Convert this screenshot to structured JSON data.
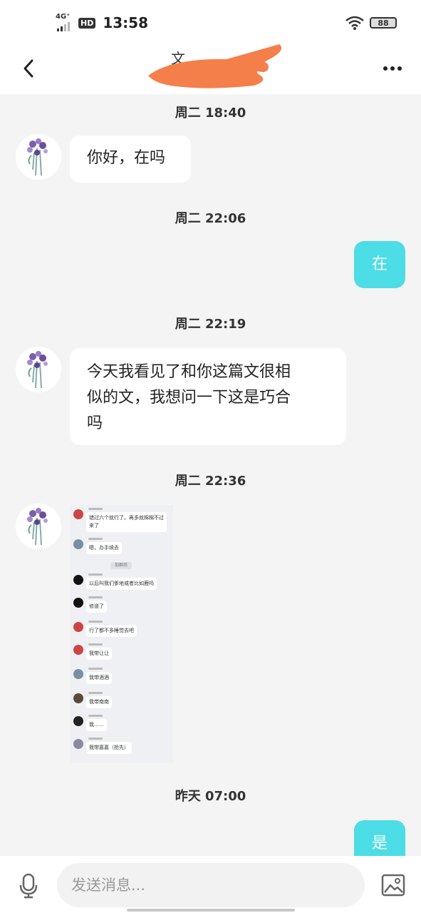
{
  "status_bar": {
    "network": "4G⁺",
    "hd": "HD",
    "time": "13:58",
    "battery": "88"
  },
  "header": {
    "title": "文"
  },
  "messages": [
    {
      "type": "timestamp",
      "text": "周二 18:40"
    },
    {
      "type": "incoming",
      "text": "你好，在吗"
    },
    {
      "type": "timestamp",
      "text": "周二 22:06"
    },
    {
      "type": "outgoing",
      "text": "在"
    },
    {
      "type": "timestamp",
      "text": "周二 22:19"
    },
    {
      "type": "incoming",
      "lines": [
        "今天我看见了和你这篇文很相",
        "似的文，我想问一下这是巧合",
        "吗"
      ]
    },
    {
      "type": "timestamp",
      "text": "周二 22:36"
    },
    {
      "type": "incoming-image",
      "description": "chat screenshot"
    },
    {
      "type": "timestamp",
      "text": "昨天 07:00"
    },
    {
      "type": "outgoing",
      "text": "是"
    }
  ],
  "shared_screenshot": {
    "rows": [
      {
        "text": "错过六个就行了。再多就棉棉不过来了",
        "lines": [
          "错过六个就行了。再多就棉棉不过",
          "来了"
        ]
      },
      {
        "text": "嗯，办手续去"
      },
      {
        "text": "加群后",
        "center": true
      },
      {
        "text": "以后叫我们爹地或者比如鹿吗"
      },
      {
        "text": "修道了"
      },
      {
        "text": "行了都不多睡觉去吧"
      },
      {
        "text": "我带让让"
      },
      {
        "text": "我带酒酒"
      },
      {
        "text": "我带南南"
      },
      {
        "text": "我……"
      },
      {
        "text": "我带嘉嘉（抢先）"
      }
    ]
  },
  "input": {
    "placeholder": "发送消息..."
  },
  "colors": {
    "accent": "#4ddde6",
    "background": "#f4f4f4",
    "redaction": "#f57f4a"
  },
  "icons": [
    "back-arrow-icon",
    "more-dots-icon",
    "microphone-icon",
    "image-icon",
    "wifi-icon",
    "signal-icon"
  ]
}
